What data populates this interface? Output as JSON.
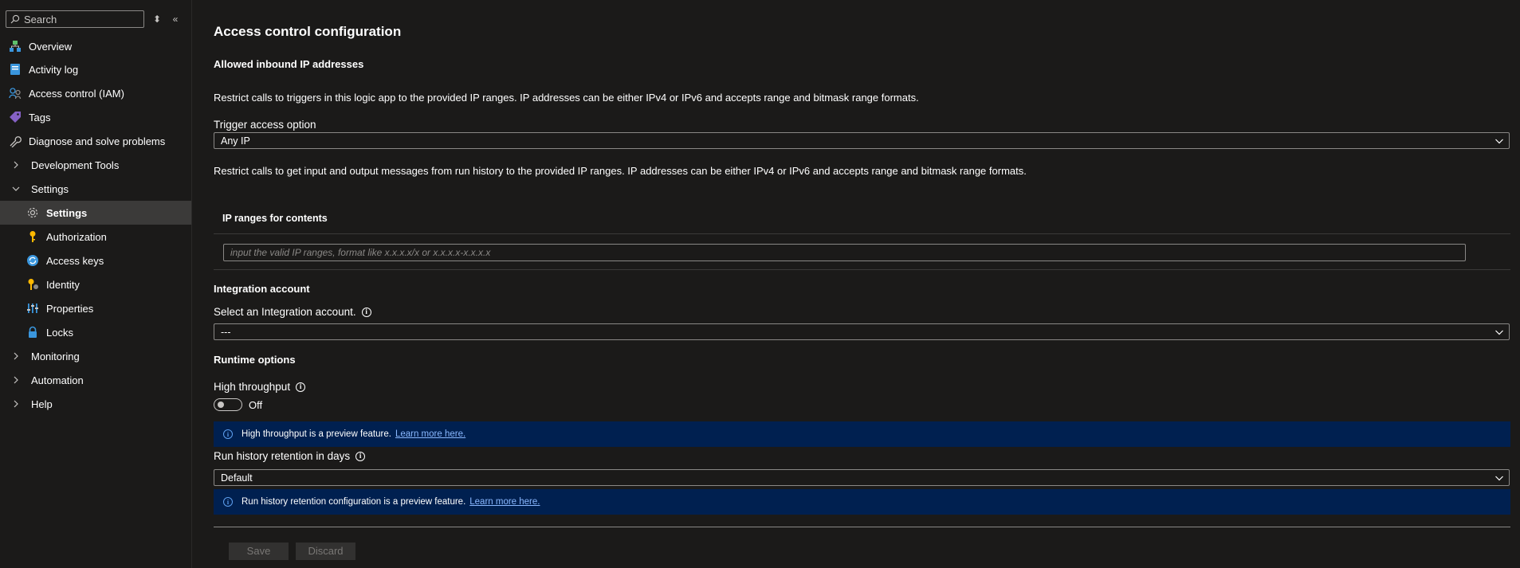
{
  "sidebar": {
    "search_placeholder": "Search",
    "items": [
      {
        "label": "Overview",
        "icon": "overview-icon"
      },
      {
        "label": "Activity log",
        "icon": "activity-log-icon"
      },
      {
        "label": "Access control (IAM)",
        "icon": "iam-icon"
      },
      {
        "label": "Tags",
        "icon": "tag-icon"
      },
      {
        "label": "Diagnose and solve problems",
        "icon": "wrench-icon"
      },
      {
        "label": "Development Tools",
        "icon": "chevron-right-icon"
      },
      {
        "label": "Settings",
        "icon": "chevron-down-icon"
      },
      {
        "label": "Settings",
        "icon": "gear-icon",
        "selected": true
      },
      {
        "label": "Authorization",
        "icon": "key-icon"
      },
      {
        "label": "Access keys",
        "icon": "access-keys-icon"
      },
      {
        "label": "Identity",
        "icon": "identity-icon"
      },
      {
        "label": "Properties",
        "icon": "properties-icon"
      },
      {
        "label": "Locks",
        "icon": "lock-icon"
      },
      {
        "label": "Monitoring",
        "icon": "chevron-right-icon"
      },
      {
        "label": "Automation",
        "icon": "chevron-right-icon"
      },
      {
        "label": "Help",
        "icon": "chevron-right-icon"
      }
    ]
  },
  "main": {
    "title": "Access control configuration",
    "inbound_heading": "Allowed inbound IP addresses",
    "trigger_description": "Restrict calls to triggers in this logic app to the provided IP ranges. IP addresses can be either IPv4 or IPv6 and accepts range and bitmask range formats.",
    "trigger_label": "Trigger access option",
    "trigger_value": "Any IP",
    "contents_description": "Restrict calls to get input and output messages from run history to the provided IP ranges. IP addresses can be either IPv4 or IPv6 and accepts range and bitmask range formats.",
    "ip_ranges_heading": "IP ranges for contents",
    "ip_ranges_placeholder": "input the valid IP ranges, format like x.x.x.x/x or x.x.x.x-x.x.x.x",
    "integration_heading": "Integration account",
    "integration_label": "Select an Integration account.",
    "integration_value": "---",
    "runtime_heading": "Runtime options",
    "throughput_label": "High throughput",
    "throughput_state": "Off",
    "throughput_info": "High throughput is a preview feature.",
    "learn_more": "Learn more here.",
    "retention_label": "Run history retention in days",
    "retention_value": "Default",
    "retention_info": "Run history retention configuration is a preview feature.",
    "save_label": "Save",
    "discard_label": "Discard"
  },
  "colors": {
    "background": "#1b1a19",
    "selected_nav": "#3b3a39",
    "info_bar": "#002050",
    "link": "#8ab8ff"
  }
}
